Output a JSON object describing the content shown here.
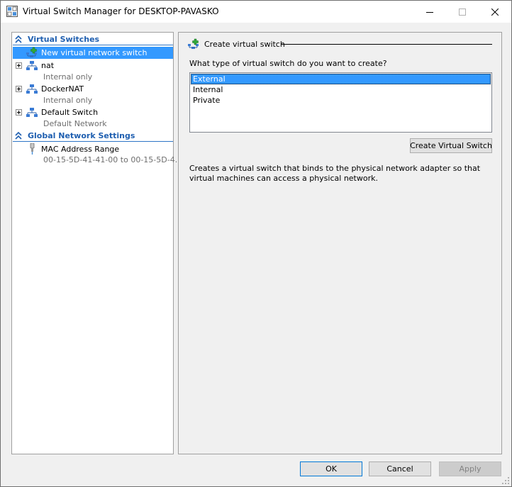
{
  "window": {
    "title": "Virtual Switch Manager for DESKTOP-PAVASKO",
    "icons": [
      "virtual-switch-manager-icon",
      "minimize-icon",
      "maximize-icon",
      "close-icon"
    ]
  },
  "sidebar": {
    "virtual_switches_header": "Virtual Switches",
    "items": [
      {
        "label": "New virtual network switch",
        "sublabel": ""
      },
      {
        "label": "nat",
        "sublabel": "Internal only"
      },
      {
        "label": "DockerNAT",
        "sublabel": "Internal only"
      },
      {
        "label": "Default Switch",
        "sublabel": "Default Network"
      }
    ],
    "global_header": "Global Network Settings",
    "global_items": [
      {
        "label": "MAC Address Range",
        "sublabel": "00-15-5D-41-41-00 to 00-15-5D-4..."
      }
    ]
  },
  "main": {
    "title": "Create virtual switch",
    "question": "What type of virtual switch do you want to create?",
    "options": [
      "External",
      "Internal",
      "Private"
    ],
    "selected_option": "External",
    "create_button": "Create Virtual Switch",
    "description": "Creates a virtual switch that binds to the physical network adapter so that virtual machines can access a physical network."
  },
  "footer": {
    "ok": "OK",
    "cancel": "Cancel",
    "apply": "Apply"
  },
  "colors": {
    "selection": "#3399ff",
    "header_text": "#1f5fb0",
    "accent_border": "#0078d7"
  }
}
